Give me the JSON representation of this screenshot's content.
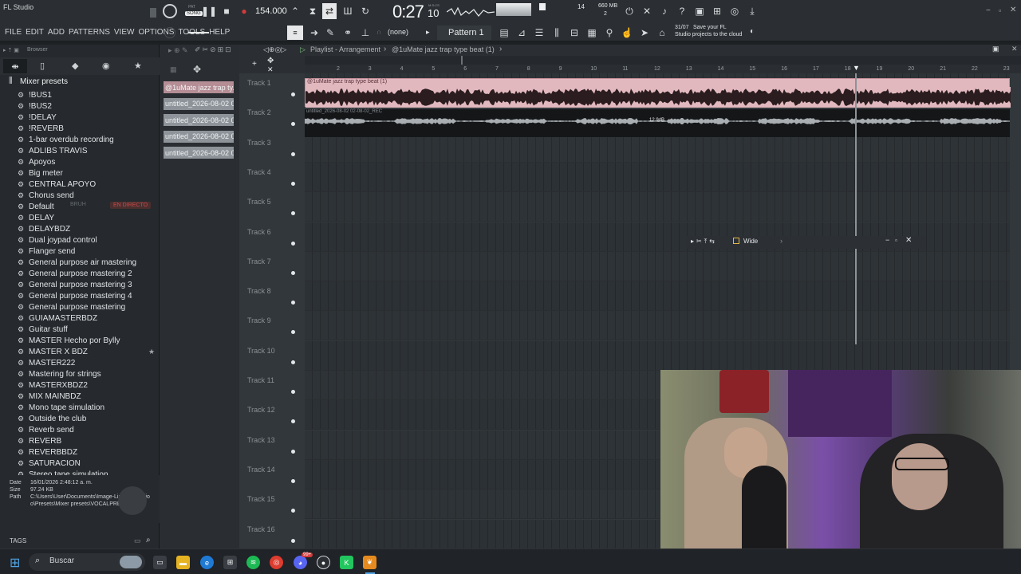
{
  "app": {
    "title": "FL Studio"
  },
  "transport": {
    "song_mode": "SONG",
    "pat_mode": "PAT",
    "tempo": "154.000",
    "time": "0:27",
    "time_sub": "10",
    "time_unit": "M:S:CS",
    "cpu_count": "14",
    "mem": "660 MB",
    "voices": "2"
  },
  "menus": [
    "FILE",
    "EDIT",
    "ADD",
    "PATTERNS",
    "VIEW",
    "OPTIONS",
    "TOOLS",
    "HELP"
  ],
  "toolbar": {
    "snap_value": "(none)",
    "pattern_label": "Pattern 1",
    "cloud_hint_date": "31/07",
    "cloud_hint_line1": "Save your FL",
    "cloud_hint_line2": "Studio projects to the cloud"
  },
  "browser": {
    "title": "Browser",
    "folder": "Mixer presets",
    "items": [
      "!BUS1",
      "!BUS2",
      "!DELAY",
      "!REVERB",
      "1-bar overdub recording",
      "ADLIBS TRAVIS",
      "Apoyos",
      "Big meter",
      "CENTRAL APOYO",
      "Chorus send",
      "Default",
      "DELAY",
      "DELAYBDZ",
      "Dual joypad control",
      "Flanger send",
      "General purpose air mastering",
      "General purpose mastering 2",
      "General purpose mastering 3",
      "General purpose mastering 4",
      "General purpose mastering",
      "GUIAMASTERBDZ",
      "Guitar stuff",
      "MASTER Hecho por Bylly",
      "MASTER X BDZ",
      "MASTER222",
      "Mastering for strings",
      "MASTERXBDZ2",
      "MIX MAINBDZ",
      "Mono tape simulation",
      "Outside the club",
      "Reverb send",
      "REVERB",
      "REVERBBDZ",
      "SATURACION",
      "Stereo tape simulation"
    ],
    "overlay_labels": {
      "bruh": "BRUH",
      "en_directo": "EN DIRECTO"
    },
    "info": {
      "date_label": "Date",
      "date_value": "16/01/2026 2:48:12 a. m.",
      "size_label": "Size",
      "size_value": "97.24 KB",
      "path_label": "Path",
      "path_value_1": "C:\\Users\\User\\Documents\\Image-Line\\FL Studio",
      "path_value_2": "o\\Presets\\Mixer presets\\VOCALPRESET2.fst"
    },
    "tags_label": "TAGS"
  },
  "pattern_clips": [
    "@1uMate jazz trap ty...",
    "untitled_2026-08-02 02-...",
    "untitled_2026-08-02 02-...",
    "untitled_2026-08-02 02-...",
    "untitled_2026-08-02 02-..."
  ],
  "playlist": {
    "title": "Playlist - Arrangement",
    "sep": "›",
    "current_clip": "@1uMate jazz trap type beat (1)",
    "clip1_label": "@1uMate jazz trap type beat (1)",
    "clip2_label": "untitled_2026-08-02 02-08-02_REC",
    "clip2_db": "12.9dB",
    "ruler": [
      "2",
      "3",
      "4",
      "5",
      "6",
      "7",
      "8",
      "9",
      "10",
      "11",
      "12",
      "13",
      "14",
      "15",
      "16",
      "17",
      "18",
      "19",
      "20",
      "21",
      "22",
      "23"
    ],
    "tracks": [
      "Track 1",
      "Track 2",
      "Track 3",
      "Track 4",
      "Track 5",
      "Track 6",
      "Track 7",
      "Track 8",
      "Track 9",
      "Track 10",
      "Track 11",
      "Track 12",
      "Track 13",
      "Track 14",
      "Track 15",
      "Track 16"
    ]
  },
  "floating_window": {
    "preset_name": "Wide"
  },
  "taskbar": {
    "search_placeholder": "Buscar",
    "discord_badge": "99+"
  },
  "colors": {
    "clip1": "#e2b8bf",
    "clip_dark": "#141618",
    "accent_red": "#d33b3b",
    "tile": "#8d9399"
  }
}
